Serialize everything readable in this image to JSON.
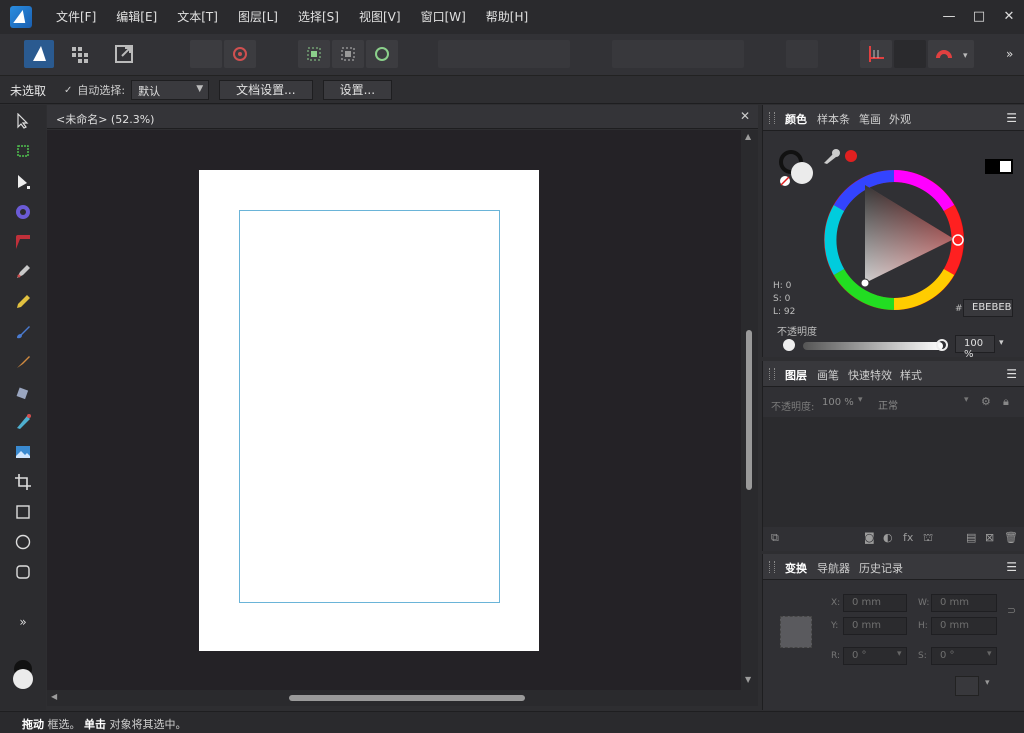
{
  "menu": [
    "文件[F]",
    "编辑[E]",
    "文本[T]",
    "图层[L]",
    "选择[S]",
    "视图[V]",
    "窗口[W]",
    "帮助[H]"
  ],
  "window_controls": [
    "—",
    "□",
    "✕"
  ],
  "context": {
    "selection_status": "未选取",
    "auto_select_label": "自动选择:",
    "auto_select_value": "默认",
    "doc_setup": "文档设置...",
    "settings": "设置..."
  },
  "document": {
    "title": "<未命名> (52.3%)"
  },
  "color_panel": {
    "tabs": [
      "颜色",
      "样本条",
      "笔画",
      "外观"
    ],
    "h": "H: 0",
    "s": "S: 0",
    "l": "L: 92",
    "hex_label": "#:",
    "hex": "EBEBEB",
    "opacity_label": "不透明度",
    "opacity_value": "100 %"
  },
  "layers_panel": {
    "tabs": [
      "图层",
      "画笔",
      "快速特效",
      "样式"
    ],
    "opacity_label": "不透明度:",
    "opacity_value": "100 %",
    "blend_mode": "正常"
  },
  "transform_panel": {
    "tabs": [
      "变换",
      "导航器",
      "历史记录"
    ],
    "x_label": "X:",
    "x_value": "0 mm",
    "y_label": "Y:",
    "y_value": "0 mm",
    "w_label": "W:",
    "w_value": "0 mm",
    "h_label": "H:",
    "h_value": "0 mm",
    "r_label": "R:",
    "r_value": "0 °",
    "s_label": "S:",
    "s_value": "0 °"
  },
  "status": {
    "bold1": "拖动",
    "text1": " 框选。",
    "bold2": "单击",
    "text2": " 对象将其选中。"
  },
  "colors": {
    "accent_blue": "#2a8de0",
    "guide": "#6ab4d8",
    "red": "#e02020"
  }
}
